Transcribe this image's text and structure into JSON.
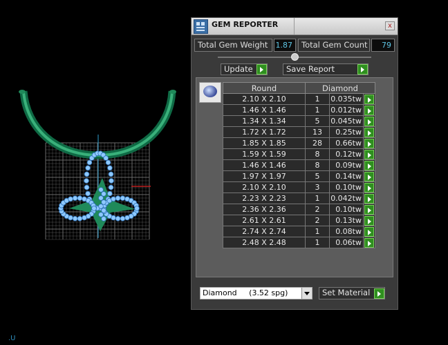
{
  "viewport": {
    "axis_label": ".U"
  },
  "panel": {
    "title": "GEM REPORTER",
    "close_label": "x",
    "total_weight_label": "Total Gem Weight",
    "total_weight_value": "1.87",
    "total_count_label": "Total Gem Count",
    "total_count_value": "79",
    "update_label": "Update",
    "save_report_label": "Save Report",
    "table": {
      "headers": [
        "Round",
        "Diamond"
      ],
      "rows": [
        {
          "size": "2.10 X 2.10",
          "count": "1",
          "weight": "0.035tw"
        },
        {
          "size": "1.46 X 1.46",
          "count": "1",
          "weight": "0.012tw"
        },
        {
          "size": "1.34 X 1.34",
          "count": "5",
          "weight": "0.045tw"
        },
        {
          "size": "1.72 X 1.72",
          "count": "13",
          "weight": "0.25tw"
        },
        {
          "size": "1.85 X 1.85",
          "count": "28",
          "weight": "0.66tw"
        },
        {
          "size": "1.59 X 1.59",
          "count": "8",
          "weight": "0.12tw"
        },
        {
          "size": "1.46 X 1.46",
          "count": "8",
          "weight": "0.09tw"
        },
        {
          "size": "1.97 X 1.97",
          "count": "5",
          "weight": "0.14tw"
        },
        {
          "size": "2.10 X 2.10",
          "count": "3",
          "weight": "0.10tw"
        },
        {
          "size": "2.23 X 2.23",
          "count": "1",
          "weight": "0.042tw"
        },
        {
          "size": "2.36 X 2.36",
          "count": "2",
          "weight": "0.10tw"
        },
        {
          "size": "2.61 X 2.61",
          "count": "2",
          "weight": "0.13tw"
        },
        {
          "size": "2.74 X 2.74",
          "count": "1",
          "weight": "0.08tw"
        },
        {
          "size": "2.48 X 2.48",
          "count": "1",
          "weight": "0.06tw"
        }
      ]
    },
    "material_value": "Diamond     (3.52 spg)",
    "set_material_label": "Set Material"
  },
  "colors": {
    "background": "#000000",
    "gem": "#8ec9ff",
    "metal": "#1f8a5a",
    "accent_green": "#2f8f1f",
    "value_text": "#5ec6e6"
  }
}
